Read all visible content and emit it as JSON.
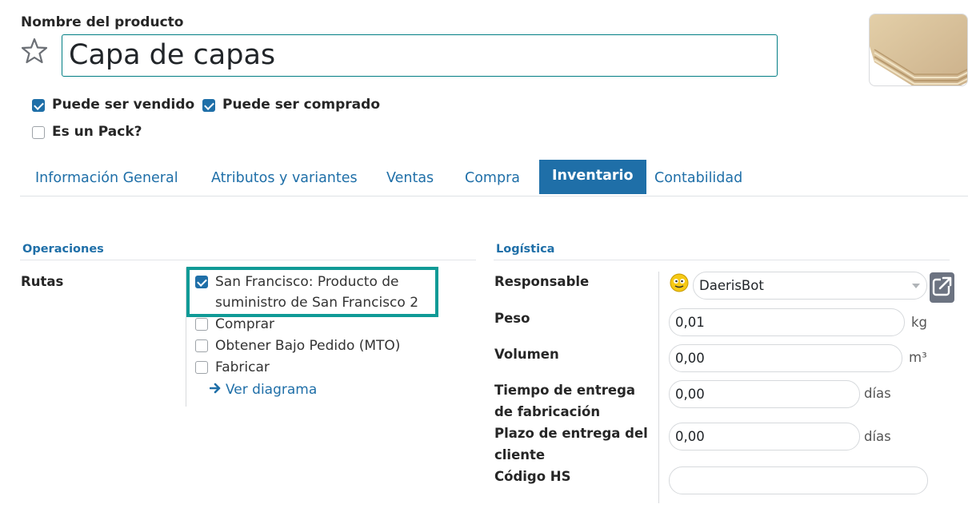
{
  "product": {
    "name_label": "Nombre del producto",
    "name_value": "Capa de capas"
  },
  "options": {
    "can_be_sold": "Puede ser vendido",
    "can_be_purchased": "Puede ser comprado",
    "is_pack": "Es un Pack?"
  },
  "tabs": [
    {
      "label": "Información General"
    },
    {
      "label": "Atributos y variantes"
    },
    {
      "label": "Ventas"
    },
    {
      "label": "Compra"
    },
    {
      "label": "Inventario"
    },
    {
      "label": "Contabilidad"
    }
  ],
  "operations": {
    "title": "Operaciones",
    "routes_label": "Rutas",
    "routes": [
      {
        "line1": "San Francisco: Producto de",
        "line2": "suministro de San Francisco 2",
        "checked": true
      },
      {
        "label": "Comprar",
        "checked": false
      },
      {
        "label": "Obtener Bajo Pedido (MTO)",
        "checked": false
      },
      {
        "label": "Fabricar",
        "checked": false
      }
    ],
    "diagram_link": "Ver diagrama"
  },
  "logistics": {
    "title": "Logística",
    "responsible_label": "Responsable",
    "responsible_value": "DaerisBot",
    "weight_label": "Peso",
    "weight_value": "0,01",
    "weight_unit": "kg",
    "volume_label": "Volumen",
    "volume_value": "0,00",
    "volume_unit": "m³",
    "mfg_lead_label_1": "Tiempo de entrega",
    "mfg_lead_label_2": "de fabricación",
    "mfg_lead_value": "0,00",
    "mfg_lead_unit": "días",
    "customer_lead_label_1": "Plazo de entrega del",
    "customer_lead_label_2": "cliente",
    "customer_lead_value": "0,00",
    "customer_lead_unit": "días",
    "hs_code_label": "Código HS",
    "hs_code_value": ""
  },
  "colors": {
    "accent": "#1f6fa8",
    "highlight": "#0f9a96",
    "input_focus": "#017e84"
  },
  "icons": {
    "favorite": "star-icon",
    "external": "external-link-icon",
    "avatar": "bot-avatar-icon",
    "arrow": "arrow-right-icon",
    "dropdown": "caret-down-icon"
  }
}
